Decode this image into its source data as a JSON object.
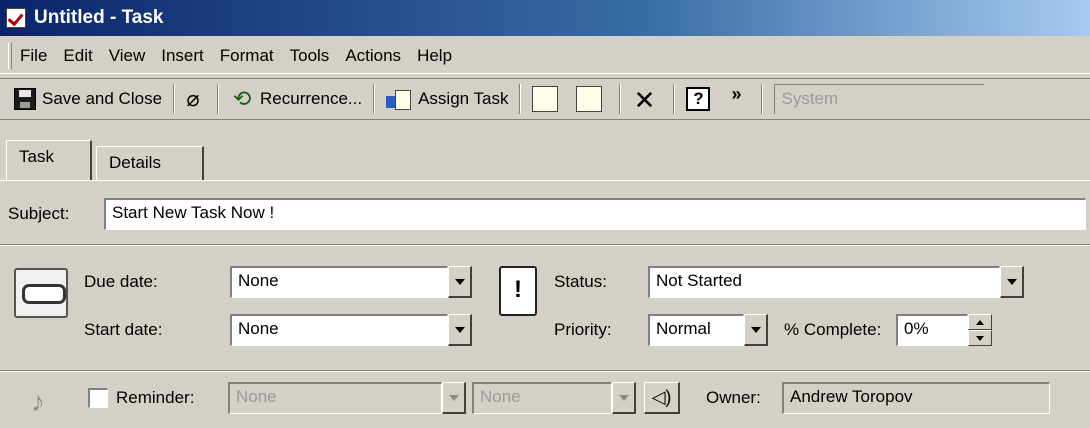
{
  "window": {
    "title": "Untitled - Task"
  },
  "menu": {
    "items": [
      "File",
      "Edit",
      "View",
      "Insert",
      "Format",
      "Tools",
      "Actions",
      "Help"
    ]
  },
  "toolbar": {
    "save_close_label": "Save and Close",
    "recurrence_label": "Recurrence...",
    "assign_task_label": "Assign Task",
    "more_label": "»",
    "style_box_value": "System"
  },
  "tabs": [
    {
      "label": "Task",
      "active": true
    },
    {
      "label": "Details",
      "active": false
    }
  ],
  "subject": {
    "label": "Subject:",
    "value": "Start New Task  Now !"
  },
  "dates": {
    "due_label": "Due date:",
    "due_value": "None",
    "start_label": "Start date:",
    "start_value": "None"
  },
  "status": {
    "label": "Status:",
    "value": "Not Started"
  },
  "priority": {
    "label": "Priority:",
    "value": "Normal"
  },
  "complete": {
    "label": "% Complete:",
    "value": "0%"
  },
  "reminder": {
    "label": "Reminder:",
    "date_value": "None",
    "time_value": "None",
    "checked": false
  },
  "owner": {
    "label": "Owner:",
    "value": "Andrew Toropov"
  },
  "icons": {
    "window": "task-check-icon",
    "save": "floppy-disk-icon",
    "attach": "paperclip-icon",
    "recurrence": "recurrence-arrows-icon",
    "assign": "assign-task-icon",
    "send_status": "send-status-report-icon",
    "mark_complete": "mark-complete-icon",
    "delete": "delete-x-icon",
    "help": "help-icon",
    "calendar": "calendar-icon",
    "priority": "priority-exclamation-icon",
    "bell": "reminder-bell-icon",
    "sound": "reminder-sound-icon"
  }
}
